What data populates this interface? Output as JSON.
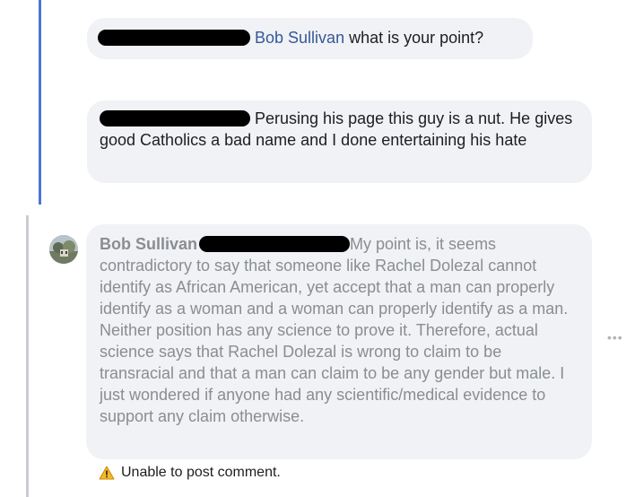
{
  "comments": [
    {
      "author_link": "Bob Sullivan",
      "text": " what is your point?"
    },
    {
      "text": "Perusing his page this guy is a nut. He gives good Catholics a bad name and I done entertaining his hate"
    },
    {
      "author": "Bob Sullivan",
      "text": "My point is, it seems contradictory to say that someone like Rachel Dolezal cannot identify as African American, yet accept that a man can properly identify as a woman and a woman can properly identify as a man. Neither position has any science to prove it. Therefore, actual science says that Rachel Dolezal is wrong to claim to be transracial and that a man can claim to be any gender but male. I just wondered if anyone had any scientific/medical evidence to support any claim otherwise.",
      "error": "Unable to post comment.",
      "more_icon": "more-horizontal-icon",
      "warning_icon": "warning-triangle-icon"
    }
  ],
  "colors": {
    "thread_line_blue": "#4a76d9",
    "thread_line_gray": "#c9cdd3",
    "bubble_bg": "#f0f2f5",
    "link": "#365899",
    "pending_text": "#8a8d91",
    "warning": "#f7b928"
  }
}
